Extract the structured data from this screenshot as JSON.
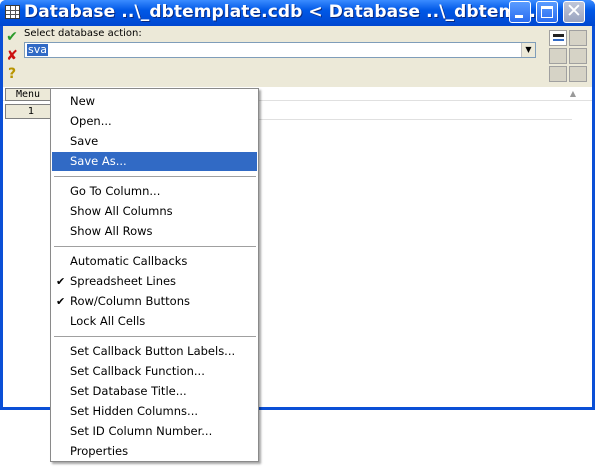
{
  "window": {
    "title": "Database ..\\_dbtemplate.cdb < Database ..\\_dbtem...",
    "accent": "#0058e6"
  },
  "action_bar": {
    "prompt": "Select database action:",
    "value": "sva",
    "icons": [
      "check-icon",
      "cross-icon",
      "help-icon"
    ]
  },
  "grid": {
    "menu_label": "Menu",
    "row_label": "1"
  },
  "context_menu": {
    "selected": "Save As...",
    "highlight_color": "#316ac5",
    "groups": [
      [
        {
          "label": "New",
          "checked": false
        },
        {
          "label": "Open...",
          "checked": false
        },
        {
          "label": "Save",
          "checked": false
        },
        {
          "label": "Save As...",
          "checked": false
        }
      ],
      [
        {
          "label": "Go To Column...",
          "checked": false
        },
        {
          "label": "Show All Columns",
          "checked": false
        },
        {
          "label": "Show All Rows",
          "checked": false
        }
      ],
      [
        {
          "label": "Automatic Callbacks",
          "checked": false
        },
        {
          "label": "Spreadsheet Lines",
          "checked": true
        },
        {
          "label": "Row/Column Buttons",
          "checked": true
        },
        {
          "label": "Lock All Cells",
          "checked": false
        }
      ],
      [
        {
          "label": "Set Callback Button Labels...",
          "checked": false
        },
        {
          "label": "Set Callback Function...",
          "checked": false
        },
        {
          "label": "Set Database Title...",
          "checked": false
        },
        {
          "label": "Set Hidden Columns...",
          "checked": false
        },
        {
          "label": "Set ID Column Number...",
          "checked": false
        },
        {
          "label": "Properties",
          "checked": false
        }
      ]
    ]
  }
}
